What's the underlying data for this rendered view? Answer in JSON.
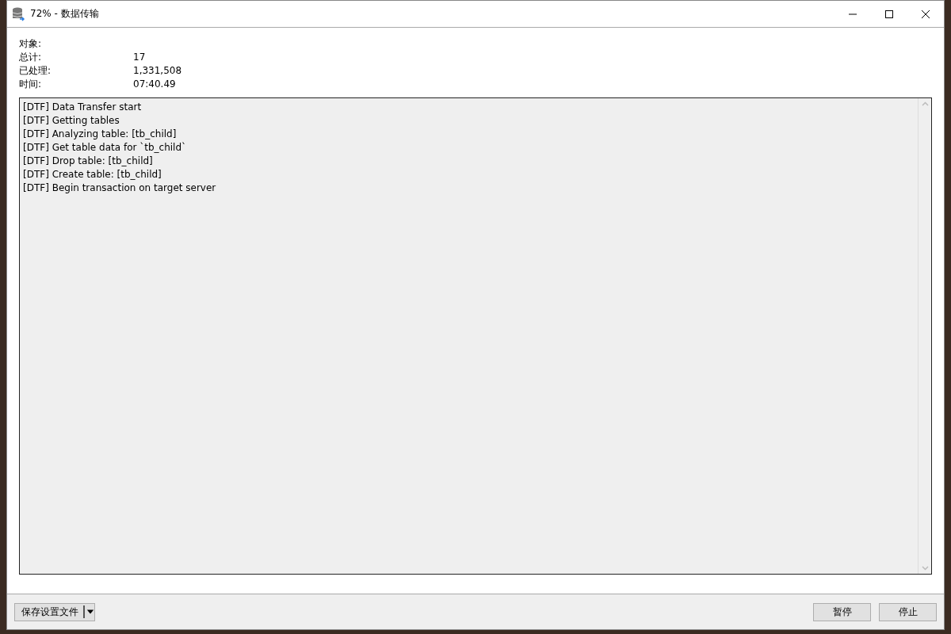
{
  "window": {
    "title": "72% - 数据传输"
  },
  "stats": [
    {
      "label": "对象:"
    },
    {
      "label": "总计:",
      "value": "17"
    },
    {
      "label": "已处理:",
      "value": "1,331,508"
    },
    {
      "label": "时间:",
      "value": "07:40.49"
    }
  ],
  "log": [
    "[DTF] Data Transfer start",
    "[DTF] Getting tables",
    "[DTF] Analyzing table: [tb_child]",
    "[DTF] Get table data for `tb_child`",
    "[DTF] Drop table: [tb_child]",
    "[DTF] Create table: [tb_child]",
    "[DTF] Begin transaction on target server"
  ],
  "footer": {
    "save_button": "保存设置文件",
    "buttons": [
      "暂停",
      "停止"
    ]
  }
}
